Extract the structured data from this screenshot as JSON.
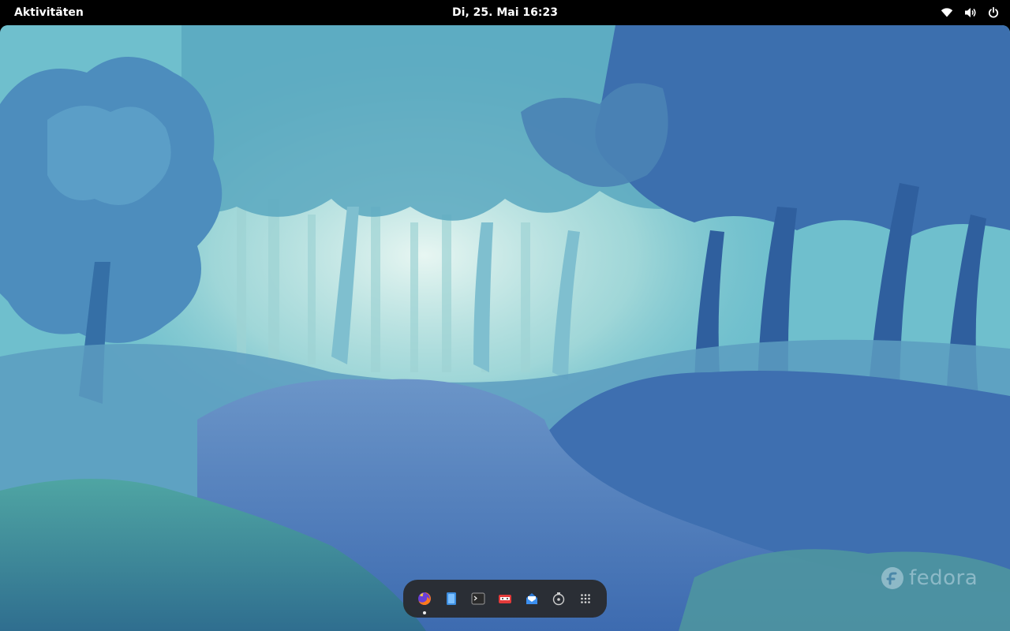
{
  "topbar": {
    "activities_label": "Aktivitäten",
    "clock_text": "Di, 25. Mai  16:23",
    "status_icons": [
      "wifi-icon",
      "volume-icon",
      "power-icon"
    ]
  },
  "desktop": {
    "watermark_text": "fedora"
  },
  "dock": {
    "items": [
      {
        "name": "firefox",
        "icon": "firefox-icon",
        "running": true
      },
      {
        "name": "files",
        "icon": "files-icon",
        "running": false
      },
      {
        "name": "terminal",
        "icon": "terminal-icon",
        "running": false
      },
      {
        "name": "software",
        "icon": "software-icon",
        "running": false
      },
      {
        "name": "mail",
        "icon": "mail-icon",
        "running": false
      },
      {
        "name": "disks",
        "icon": "disks-icon",
        "running": false
      },
      {
        "name": "app-grid",
        "icon": "app-grid-icon",
        "running": false
      }
    ]
  },
  "colors": {
    "topbar_bg": "#000000",
    "dock_bg": "#28282a",
    "wallpaper_teal": "#7cc6cf",
    "wallpaper_deep_blue": "#2f5f96"
  }
}
